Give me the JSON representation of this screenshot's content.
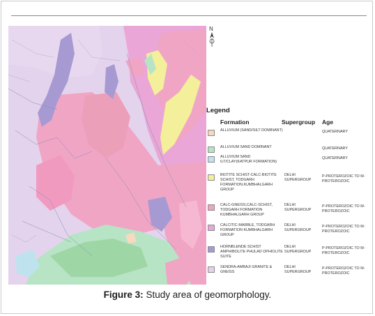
{
  "legend": {
    "title": "Legend",
    "headers": {
      "formation": "Formation",
      "supergroup": "Supergroup",
      "age": "Age"
    },
    "items": [
      {
        "formation": "ALLUVIUM (SAND/SILT DOMINANT)",
        "supergroup": "",
        "age": "QUATERNARY",
        "color": "#f6d9bf"
      },
      {
        "formation": "ALLUVIUM SAND DOMINANT",
        "supergroup": "",
        "age": "QUATERNARY",
        "color": "#b7e4c4"
      },
      {
        "formation": "ALLUVIUM SAND ILT/CLAY(KATPUR FORMATION)",
        "supergroup": "",
        "age": "QUATERNARY",
        "color": "#bfe3ee"
      },
      {
        "formation": "BIOTITE SCHIST-CALC-BIOTITE SCHIST, TODGARH FORMATION,KUMBHALGARH GROUP",
        "supergroup": "DELHI SUPERGROUP",
        "age": "P-PROTEROZOIC TO M-PROTEROZOIC",
        "color": "#f3ef9a"
      },
      {
        "formation": "CALC-GNEISS,CALC-SCHIST, TODGARH FORMATION KUMBHALGARH GROUP",
        "supergroup": "DELHI SUPERGROUP",
        "age": "P-PROTEROZOIC TO M-PROTEROZOIC",
        "color": "#f2a2c3"
      },
      {
        "formation": "CALCITIC-MARBLE, TODGARH FORMATION KUMBHALGARH GROUP",
        "supergroup": "DELHI SUPERGROUP",
        "age": "P-PROTEROZOIC TO M-PROTEROZOIC",
        "color": "#e4a9d9"
      },
      {
        "formation": "HORNBLENDE SCHIST AMPHIBOLITE PHULAD OPHIOLITE SUITE",
        "supergroup": "DELHI SUPERGROUP",
        "age": "P-PROTEROZOIC TO M-PROTEROZOIC",
        "color": "#a79ad3"
      },
      {
        "formation": "SENDRA-AMBAJI GRANITE & GNEISS",
        "supergroup": "DELHI SUPERGROUP",
        "age": "P-PROTEROZOIC TO M-PROTEROZOIC",
        "color": "#e3d2ea"
      }
    ]
  },
  "north_label": "N",
  "caption": {
    "label": "Figure 3:",
    "text": " Study area of geomorphology."
  }
}
